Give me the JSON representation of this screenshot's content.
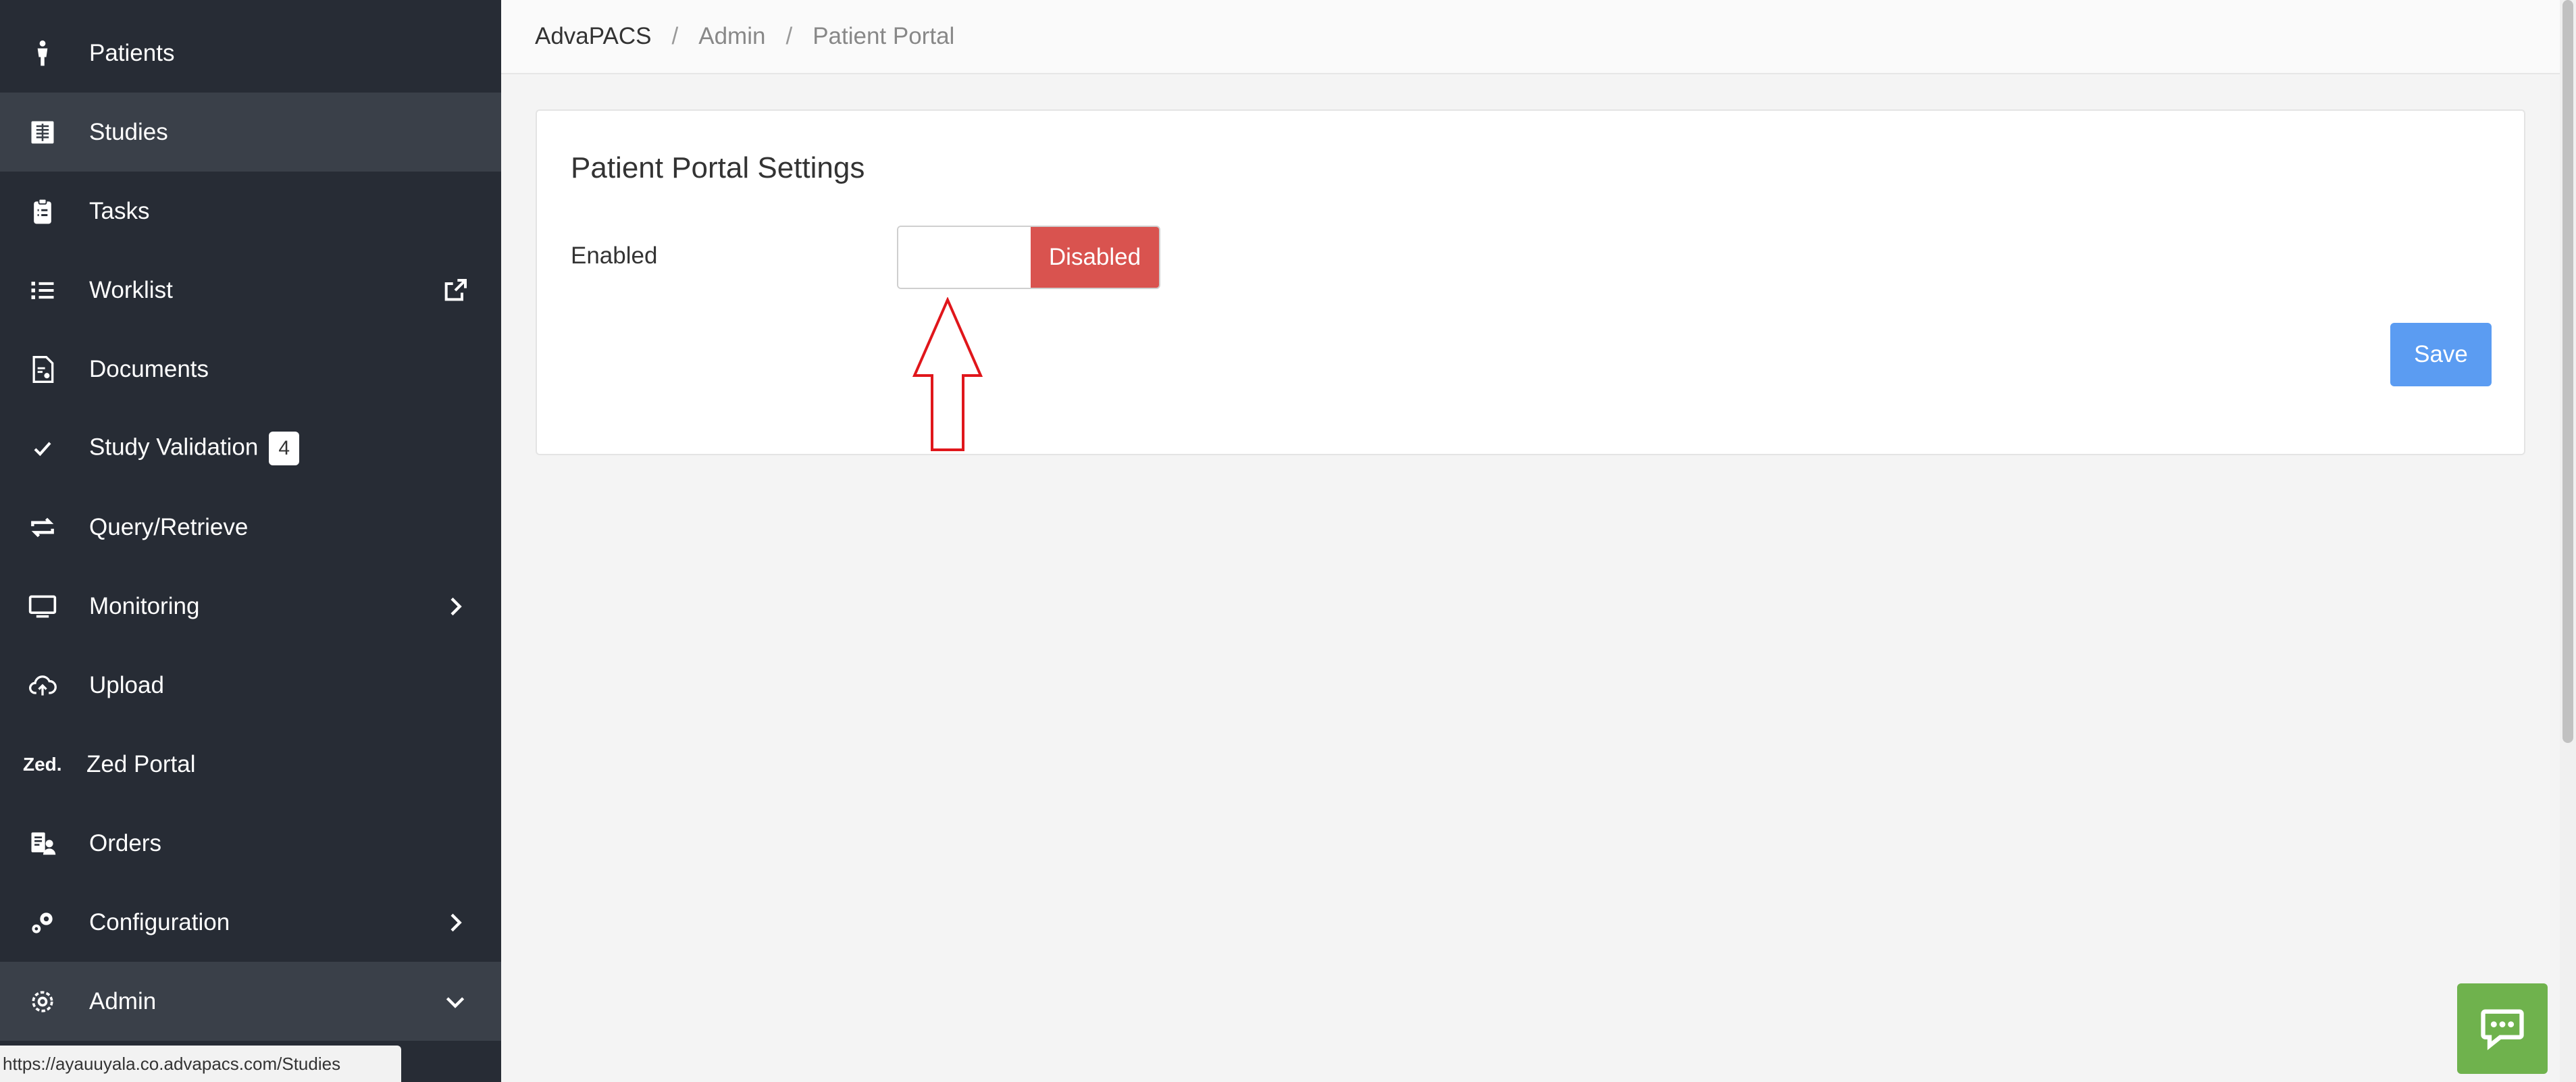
{
  "sidebar": {
    "items": [
      {
        "label": "Patients",
        "icon": "person-icon"
      },
      {
        "label": "Studies",
        "icon": "studies-icon",
        "active": true
      },
      {
        "label": "Tasks",
        "icon": "clipboard-icon"
      },
      {
        "label": "Worklist",
        "icon": "list-icon",
        "trail_icon": "external-link-icon"
      },
      {
        "label": "Documents",
        "icon": "document-icon"
      },
      {
        "label": "Study Validation",
        "icon": "check-icon",
        "badge": "4"
      },
      {
        "label": "Query/Retrieve",
        "icon": "retweet-icon"
      },
      {
        "label": "Monitoring",
        "icon": "monitor-icon",
        "trail_icon": "chevron-right-icon"
      },
      {
        "label": "Upload",
        "icon": "cloud-upload-icon"
      },
      {
        "label": "Zed Portal",
        "icon_text": "Zed."
      },
      {
        "label": "Orders",
        "icon": "orders-icon"
      },
      {
        "label": "Configuration",
        "icon": "cogs-icon",
        "trail_icon": "chevron-right-icon"
      },
      {
        "label": "Admin",
        "icon": "gear-icon",
        "trail_icon": "chevron-down-icon",
        "active": true
      }
    ]
  },
  "status_bar": {
    "url": "https://ayauuyala.co.advapacs.com/Studies"
  },
  "breadcrumb": {
    "root": "AdvaPACS",
    "separator": "/",
    "items": [
      "Admin",
      "Patient Portal"
    ]
  },
  "card": {
    "title": "Patient Portal Settings",
    "enabled_label": "Enabled",
    "toggle_state": "Disabled",
    "save_label": "Save"
  },
  "colors": {
    "sidebar_bg": "#272c35",
    "disabled_red": "#d9534f",
    "save_blue": "#5b9cf2",
    "chat_green": "#6fb24d",
    "arrow_red": "#e0161b"
  }
}
